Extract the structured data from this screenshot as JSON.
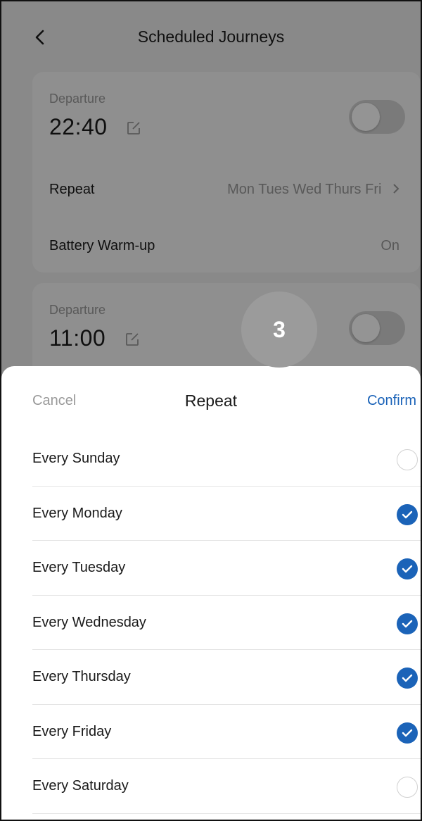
{
  "header": {
    "title": "Scheduled Journeys"
  },
  "schedules": [
    {
      "departure_label": "Departure",
      "time": "22:40",
      "repeat_label": "Repeat",
      "repeat_value": "Mon Tues Wed Thurs Fri",
      "warmup_label": "Battery Warm-up",
      "warmup_value": "On"
    },
    {
      "departure_label": "Departure",
      "time": "11:00"
    }
  ],
  "step_badge": "3",
  "sheet": {
    "cancel": "Cancel",
    "title": "Repeat",
    "confirm": "Confirm",
    "options": [
      {
        "label": "Every Sunday",
        "checked": false
      },
      {
        "label": "Every Monday",
        "checked": true
      },
      {
        "label": "Every Tuesday",
        "checked": true
      },
      {
        "label": "Every Wednesday",
        "checked": true
      },
      {
        "label": "Every Thursday",
        "checked": true
      },
      {
        "label": "Every Friday",
        "checked": true
      },
      {
        "label": "Every Saturday",
        "checked": false
      }
    ]
  },
  "colors": {
    "accent": "#1b63b8",
    "muted": "#9a9a9a"
  }
}
